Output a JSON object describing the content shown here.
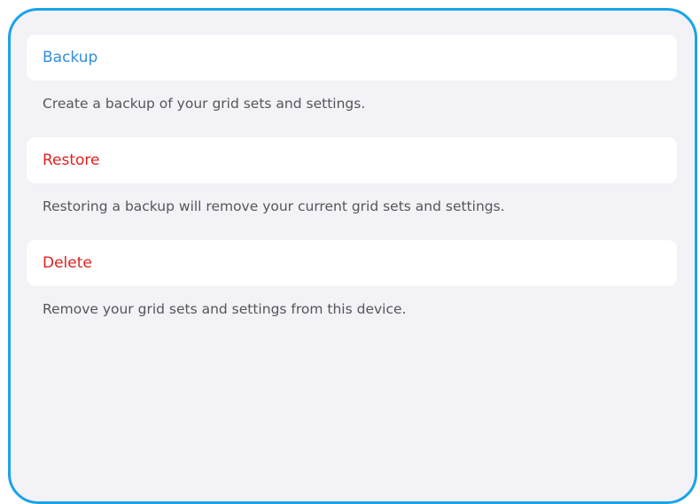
{
  "settings": {
    "items": [
      {
        "label": "Backup",
        "description": "Create a backup of your grid sets and settings."
      },
      {
        "label": "Restore",
        "description": "Restoring a backup will remove your current grid sets and settings."
      },
      {
        "label": "Delete",
        "description": "Remove your grid sets and settings from this device."
      }
    ]
  },
  "colors": {
    "frame_border": "#1aa3e8",
    "background": "#f2f2f7",
    "backup_text": "#2f8ee0",
    "destructive_text": "#e0211e",
    "description_text": "#55555a"
  }
}
